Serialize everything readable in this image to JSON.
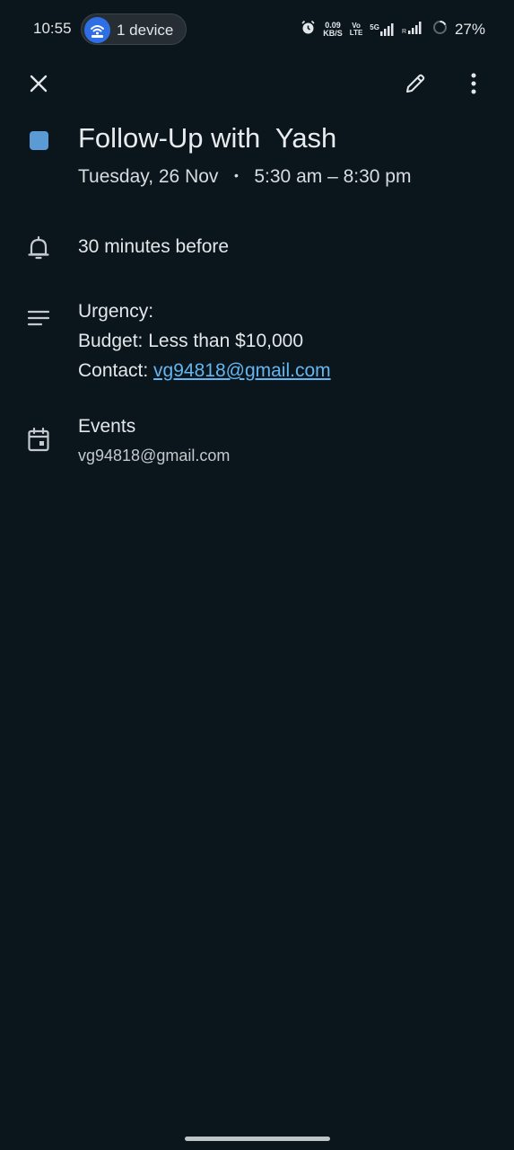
{
  "status_bar": {
    "time": "10:55",
    "hotspot_label": "1 device",
    "net_speed_value": "0.09",
    "net_speed_unit": "KB/S",
    "volte_top": "Vo",
    "volte_bottom": "LTE",
    "network_type": "5G",
    "battery": "27%"
  },
  "event": {
    "color": "#5b9bd5",
    "title": "Follow-Up with  Yash",
    "date": "Tuesday, 26 Nov",
    "separator": "•",
    "time_range": "5:30 am – 8:30 pm",
    "reminder": "30 minutes before",
    "description": {
      "line1": "Urgency:",
      "line2": "Budget: Less than $10,000",
      "contact_label": "Contact: ",
      "contact_email": "vg94818@gmail.com"
    },
    "calendar": {
      "name": "Events",
      "account": "vg94818@gmail.com"
    }
  },
  "icons": {
    "close": "close-icon",
    "edit": "pencil-icon",
    "more": "more-vert-icon",
    "reminder": "bell-icon",
    "description": "notes-icon",
    "calendar": "calendar-icon"
  }
}
